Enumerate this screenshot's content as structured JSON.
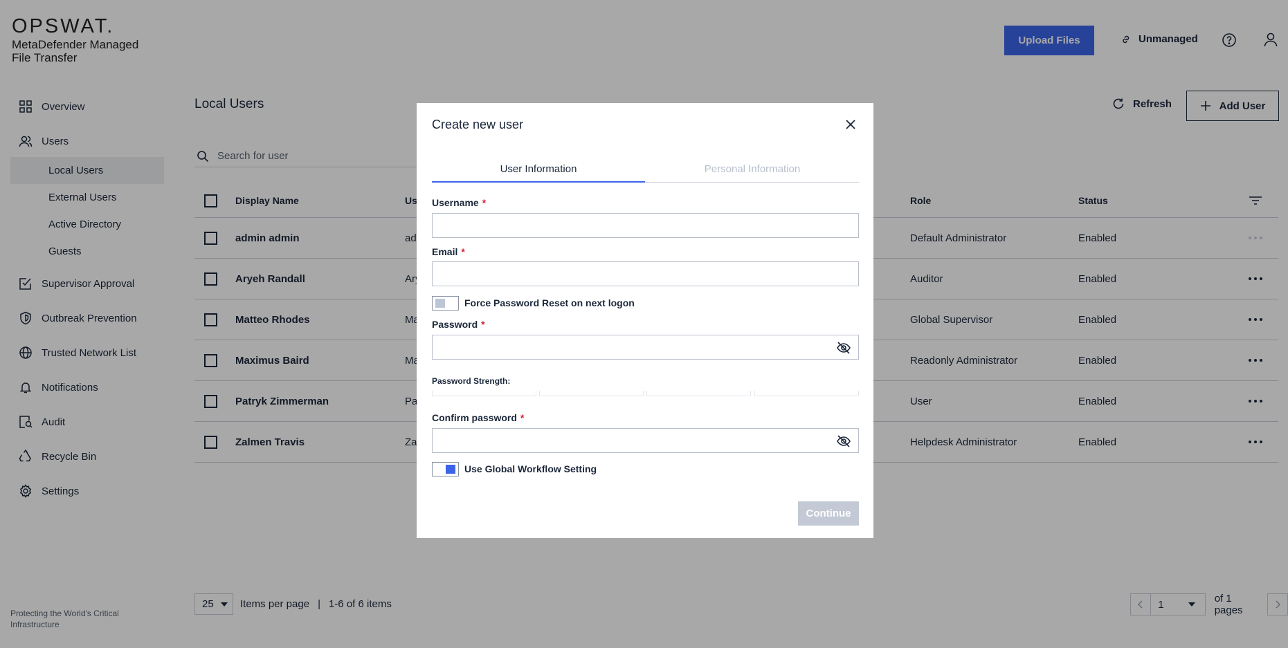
{
  "brand": {
    "logo": "OPSWAT.",
    "product": "MetaDefender Managed File Transfer",
    "tagline": "Protecting the World's Critical Infrastructure"
  },
  "header": {
    "upload_label": "Upload Files",
    "unmanaged_label": "Unmanaged"
  },
  "sidebar": {
    "items": [
      {
        "label": "Overview",
        "icon": "grid-icon"
      },
      {
        "label": "Users",
        "icon": "users-icon"
      },
      {
        "label": "Supervisor Approval",
        "icon": "check-doc-icon"
      },
      {
        "label": "Outbreak Prevention",
        "icon": "shield-icon"
      },
      {
        "label": "Trusted Network List",
        "icon": "globe-icon"
      },
      {
        "label": "Notifications",
        "icon": "bell-icon"
      },
      {
        "label": "Audit",
        "icon": "audit-icon"
      },
      {
        "label": "Recycle Bin",
        "icon": "recycle-icon"
      },
      {
        "label": "Settings",
        "icon": "gear-icon"
      }
    ],
    "user_subitems": [
      "Local Users",
      "External Users",
      "Active Directory",
      "Guests"
    ],
    "active_subitem": "Local Users"
  },
  "main": {
    "title": "Local Users",
    "refresh_label": "Refresh",
    "add_user_label": "Add User",
    "search_placeholder": "Search for user",
    "columns": {
      "name": "Display Name",
      "username": "Us",
      "role": "Role",
      "status": "Status"
    },
    "rows": [
      {
        "name": "admin admin",
        "username": "ad",
        "role": "Default Administrator",
        "status": "Enabled"
      },
      {
        "name": "Aryeh Randall",
        "username": "Ary",
        "role": "Auditor",
        "status": "Enabled"
      },
      {
        "name": "Matteo Rhodes",
        "username": "Ma",
        "role": "Global Supervisor",
        "status": "Enabled"
      },
      {
        "name": "Maximus Baird",
        "username": "Ma",
        "role": "Readonly Administrator",
        "status": "Enabled"
      },
      {
        "name": "Patryk Zimmerman",
        "username": "Pa",
        "role": "User",
        "status": "Enabled"
      },
      {
        "name": "Zalmen Travis",
        "username": "Za",
        "role": "Helpdesk Administrator",
        "status": "Enabled"
      }
    ],
    "pager": {
      "per_page": "25",
      "per_page_label": "Items per page",
      "separator": "|",
      "range": "1-6 of 6 items",
      "page": "1",
      "of_pages": "of 1 pages"
    }
  },
  "modal": {
    "title": "Create new user",
    "tabs": [
      "User Information",
      "Personal Information"
    ],
    "active_tab": "User Information",
    "username_label": "Username",
    "email_label": "Email",
    "required_mark": "*",
    "force_reset_label": "Force Password Reset on next logon",
    "force_reset_on": false,
    "password_label": "Password",
    "strength_label": "Password Strength:",
    "confirm_label": "Confirm password",
    "global_workflow_label": "Use Global Workflow Setting",
    "global_workflow_on": true,
    "continue_label": "Continue"
  },
  "colors": {
    "accent": "#3c64e8",
    "required": "#d0202e",
    "disabled_button": "#c3cad5",
    "overlay": "rgba(0,0,0,0.34)"
  }
}
